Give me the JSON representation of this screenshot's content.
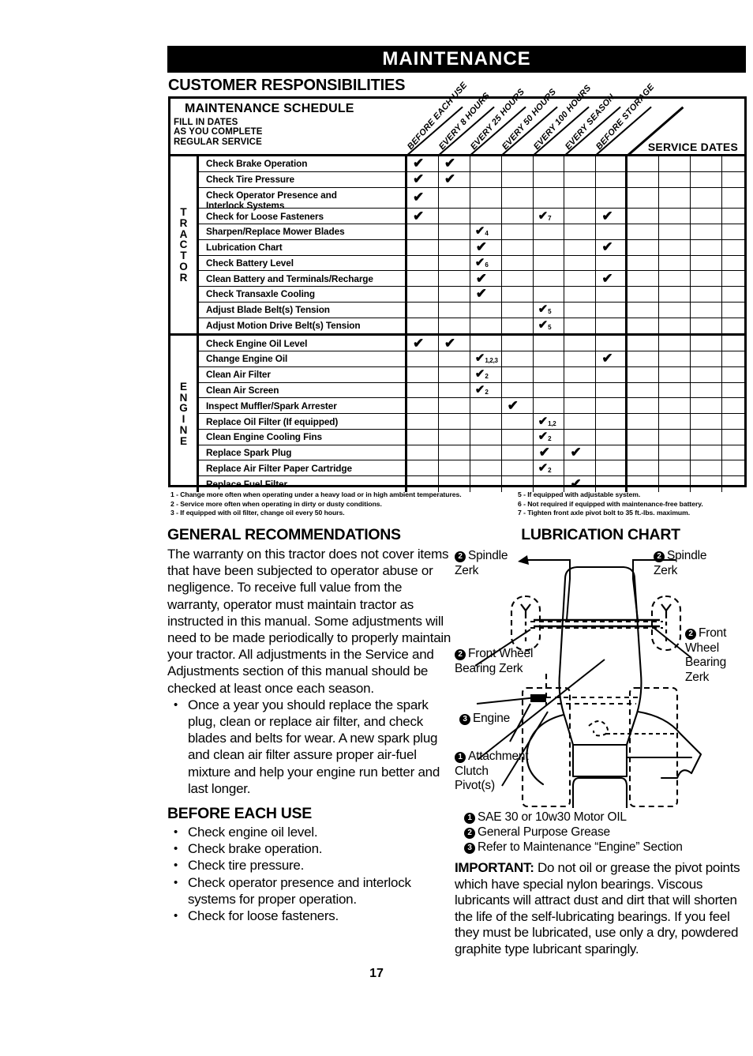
{
  "header": {
    "banner_title": "MAINTENANCE",
    "section_title": "CUSTOMER RESPONSIBILITIES"
  },
  "schedule": {
    "title": "MAINTENANCE SCHEDULE",
    "subtitle": "FILL IN DATES\nAS YOU COMPLETE\nREGULAR SERVICE",
    "service_dates_label": "SERVICE DATES",
    "columns": [
      "BEFORE EACH USE",
      "EVERY 8 HOURS",
      "EVERY 25 HOURS",
      "EVERY 50 HOURS",
      "EVERY 100 HOURS",
      "EVERY SEASON",
      "BEFORE STORAGE"
    ],
    "service_date_columns": 5,
    "check_glyph": "✔",
    "groups": [
      {
        "name": "TRACTOR",
        "letters": [
          "T",
          "R",
          "A",
          "C",
          "T",
          "O",
          "R"
        ],
        "rows": [
          {
            "label": "Check Brake Operation",
            "marks": [
              {
                "col": 0
              },
              {
                "col": 1
              }
            ]
          },
          {
            "label": "Check Tire Pressure",
            "marks": [
              {
                "col": 0
              },
              {
                "col": 1
              }
            ]
          },
          {
            "label": "Check Operator Presence and\nInterlock Systems",
            "two_line": true,
            "marks": [
              {
                "col": 0
              }
            ]
          },
          {
            "label": "Check for Loose Fasteners",
            "marks": [
              {
                "col": 0
              },
              {
                "col": 4,
                "note": "7"
              },
              {
                "col": 6
              }
            ]
          },
          {
            "label": "Sharpen/Replace Mower Blades",
            "marks": [
              {
                "col": 2,
                "note": "4"
              }
            ]
          },
          {
            "label": "Lubrication Chart",
            "marks": [
              {
                "col": 2
              },
              {
                "col": 6
              }
            ]
          },
          {
            "label": "Check Battery Level",
            "marks": [
              {
                "col": 2,
                "note": "6"
              }
            ]
          },
          {
            "label": "Clean Battery and Terminals/Recharge",
            "marks": [
              {
                "col": 2
              },
              {
                "col": 6
              }
            ]
          },
          {
            "label": "Check Transaxle Cooling",
            "marks": [
              {
                "col": 2
              }
            ]
          },
          {
            "label": "Adjust Blade Belt(s) Tension",
            "marks": [
              {
                "col": 4,
                "note": "5"
              }
            ]
          },
          {
            "label": "Adjust Motion Drive Belt(s) Tension",
            "marks": [
              {
                "col": 4,
                "note": "5"
              }
            ]
          }
        ]
      },
      {
        "name": "ENGINE",
        "letters": [
          "E",
          "N",
          "G",
          "I",
          "N",
          "E"
        ],
        "rows": [
          {
            "label": "Check Engine Oil Level",
            "marks": [
              {
                "col": 0
              },
              {
                "col": 1
              }
            ]
          },
          {
            "label": "Change Engine Oil",
            "marks": [
              {
                "col": 2,
                "note": "1,2,3"
              },
              {
                "col": 6
              }
            ]
          },
          {
            "label": "Clean Air Filter",
            "marks": [
              {
                "col": 2,
                "note": "2"
              }
            ]
          },
          {
            "label": "Clean Air Screen",
            "marks": [
              {
                "col": 2,
                "note": "2"
              }
            ]
          },
          {
            "label": "Inspect Muffler/Spark Arrester",
            "marks": [
              {
                "col": 3
              }
            ]
          },
          {
            "label": "Replace Oil Filter (If equipped)",
            "marks": [
              {
                "col": 4,
                "note": "1,2"
              }
            ]
          },
          {
            "label": "Clean Engine Cooling Fins",
            "marks": [
              {
                "col": 4,
                "note": "2"
              }
            ],
            "trailing_dash": true
          },
          {
            "label": "Replace Spark Plug",
            "marks": [
              {
                "col": 4
              },
              {
                "col": 5
              }
            ]
          },
          {
            "label": "Replace Air Filter Paper Cartridge",
            "marks": [
              {
                "col": 4,
                "note": "2"
              }
            ]
          },
          {
            "label": "Replace Fuel Filter",
            "marks": [
              {
                "col": 5
              }
            ]
          }
        ]
      }
    ],
    "footnotes_left": [
      "1 - Change more often when operating under a heavy load or in high ambient temperatures.",
      "2 - Service more often when operating in dirty or dusty conditions.",
      "3 - If equipped with oil filter, change oil every 50 hours."
    ],
    "footnotes_right": [
      "5 - If equipped with adjustable system.",
      "6 - Not required if equipped with maintenance-free battery.",
      "7 - Tighten front axle pivot bolt to 35 ft.-lbs. maximum."
    ]
  },
  "general": {
    "heading": "GENERAL RECOMMENDATIONS",
    "paragraph": "The warranty on this tractor does not cover items that have been subjected to operator abuse or negligence. To receive full value from the warranty, operator must maintain tractor as instructed in this manual. Some adjustments will need to be made periodically to properly maintain your tractor. All adjustments in the Service and Adjustments section of this manual should be checked at least once each season.",
    "bullets": [
      "Once a year you should replace the spark plug, clean or replace air filter, and check blades and belts for wear. A new spark plug and clean air filter assure proper air-fuel mixture and help your engine run better and last longer."
    ]
  },
  "before_each_use": {
    "heading": "BEFORE EACH USE",
    "bullets": [
      "Check engine oil level.",
      "Check brake operation.",
      "Check tire pressure.",
      "Check operator presence and interlock systems for proper operation.",
      "Check for loose fasteners."
    ]
  },
  "lubrication": {
    "heading": "LUBRICATION CHART",
    "callouts": {
      "spindle_left": {
        "num": "2",
        "text": "Spindle\nZerk"
      },
      "spindle_right": {
        "num": "2",
        "text": "Spindle\nZerk"
      },
      "front_wheel_left": {
        "num": "2",
        "text": "Front Wheel\nBearing Zerk"
      },
      "front_wheel_right": {
        "num": "2",
        "text": "Front\nWheel\nBearing\nZerk"
      },
      "engine": {
        "num": "3",
        "text": "Engine"
      },
      "attachment": {
        "num": "1",
        "text": "Attachment\nClutch\nPivot(s)"
      }
    },
    "legend": [
      {
        "num": "1",
        "text": "SAE 30 or 10w30 Motor OIL"
      },
      {
        "num": "2",
        "text": "General Purpose Grease"
      },
      {
        "num": "3",
        "text": "Refer to Maintenance “Engine” Section"
      }
    ],
    "important_label": "IMPORTANT:",
    "important_text": " Do not oil or grease the pivot points which have special nylon bearings. Viscous lubricants will attract dust and dirt that will shorten the life of the self-lubricating bearings. If you feel they must be lubricated, use only a dry, powdered graphite type lubricant sparingly."
  },
  "footer": {
    "page_number": "17"
  }
}
